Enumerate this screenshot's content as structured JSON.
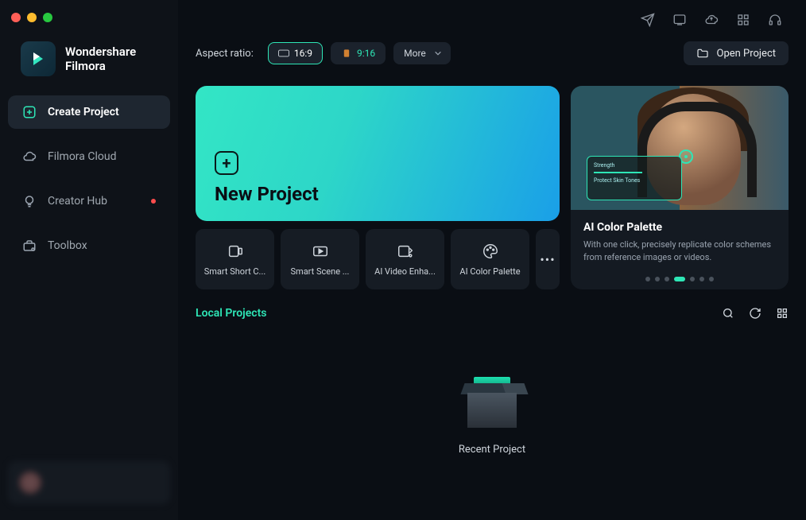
{
  "brand": {
    "line1": "Wondershare",
    "line2": "Filmora"
  },
  "sidebar": {
    "items": [
      {
        "label": "Create Project",
        "icon": "plus-square-icon"
      },
      {
        "label": "Filmora Cloud",
        "icon": "cloud-icon"
      },
      {
        "label": "Creator Hub",
        "icon": "bulb-icon",
        "has_dot": true
      },
      {
        "label": "Toolbox",
        "icon": "toolbox-icon"
      }
    ]
  },
  "top": {
    "aspect_ratio_label": "Aspect ratio:",
    "ratios": [
      {
        "label": "16:9",
        "selected": true
      },
      {
        "label": "9:16",
        "selected": false,
        "accent": "#ff9933"
      }
    ],
    "more_label": "More",
    "open_project_label": "Open Project"
  },
  "new_project": {
    "title": "New Project"
  },
  "tools": [
    {
      "label": "Smart Short C...",
      "icon": "smart-short-icon"
    },
    {
      "label": "Smart Scene ...",
      "icon": "smart-scene-icon"
    },
    {
      "label": "AI Video Enha...",
      "icon": "ai-enhance-icon"
    },
    {
      "label": "AI Color Palette",
      "icon": "color-palette-icon"
    }
  ],
  "promo": {
    "title": "AI Color Palette",
    "description": "With one click, precisely replicate color schemes from reference images or videos.",
    "panel_line1": "Strength",
    "panel_line2": "Protect Skin Tones",
    "dots": 7,
    "active_dot": 3
  },
  "sections": {
    "local_projects_label": "Local Projects",
    "empty_label": "Recent Project"
  }
}
